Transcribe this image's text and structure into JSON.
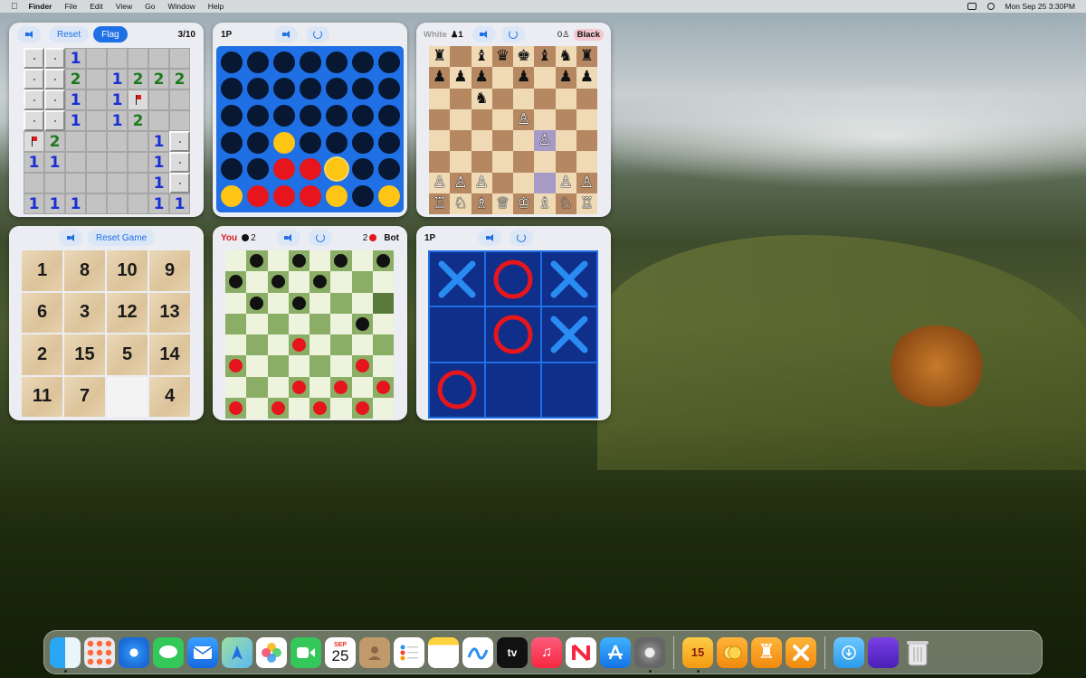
{
  "menubar": {
    "app_name": "Finder",
    "menus": [
      "File",
      "Edit",
      "View",
      "Go",
      "Window",
      "Help"
    ],
    "datetime": "Mon Sep 25  3:30PM"
  },
  "minesweeper": {
    "reset_label": "Reset",
    "flag_label": "Flag",
    "counter": "3/10",
    "grid": [
      [
        "c",
        "c",
        "1",
        "",
        "",
        "",
        "",
        ""
      ],
      [
        "c",
        "c",
        "2",
        "",
        "1",
        "2",
        "2",
        "2"
      ],
      [
        "c",
        "c",
        "1",
        "",
        "1",
        "F",
        "",
        ""
      ],
      [
        "c",
        "c",
        "1",
        "",
        "1",
        "2",
        "",
        ""
      ],
      [
        "F",
        "2",
        "",
        "",
        "",
        "",
        "1",
        "c"
      ],
      [
        "1",
        "1",
        "",
        "",
        "",
        "",
        "1",
        "c"
      ],
      [
        "",
        "",
        "",
        "",
        "",
        "",
        "1",
        "c"
      ],
      [
        "1",
        "1",
        "1",
        "",
        "",
        "",
        "1",
        "1"
      ]
    ]
  },
  "connect_four": {
    "mode": "1P",
    "grid": [
      [
        ".",
        ".",
        ".",
        ".",
        ".",
        ".",
        "."
      ],
      [
        ".",
        ".",
        ".",
        ".",
        ".",
        ".",
        "."
      ],
      [
        ".",
        ".",
        ".",
        ".",
        ".",
        ".",
        "."
      ],
      [
        ".",
        ".",
        "y",
        ".",
        ".",
        ".",
        "."
      ],
      [
        ".",
        ".",
        "r",
        "r",
        "Y",
        ".",
        "."
      ],
      [
        "y",
        "r",
        "r",
        "r",
        "y",
        ".",
        "y"
      ]
    ]
  },
  "chess": {
    "white_label": "White",
    "white_captured": "♟1",
    "black_captured": "0♙",
    "black_label": "Black",
    "board": [
      [
        "♜",
        "",
        "♝",
        "♛",
        "♚",
        "♝",
        "♞",
        "♜"
      ],
      [
        "♟",
        "♟",
        "♟",
        "",
        "♟",
        "",
        "♟",
        "♟"
      ],
      [
        "",
        "",
        "♞",
        "",
        "",
        "",
        "",
        ""
      ],
      [
        "",
        "",
        "",
        "",
        "♙",
        "",
        "",
        ""
      ],
      [
        "",
        "",
        "",
        "",
        "",
        "♙",
        "",
        ""
      ],
      [
        "",
        "",
        "",
        "",
        "",
        "",
        "",
        ""
      ],
      [
        "♙",
        "♙",
        "♙",
        "",
        "",
        "",
        "♙",
        "♙"
      ],
      [
        "♖",
        "♘",
        "♗",
        "♕",
        "♔",
        "♗",
        "♘",
        "♖"
      ]
    ],
    "highlight": [
      "4-5",
      "6-5"
    ]
  },
  "puzzle15": {
    "reset_label": "Reset Game",
    "tiles": [
      "1",
      "8",
      "10",
      "9",
      "6",
      "3",
      "12",
      "13",
      "2",
      "15",
      "5",
      "14",
      "11",
      "7",
      "",
      "4"
    ]
  },
  "checkers": {
    "you_label": "You",
    "you_score": "2",
    "bot_score": "2",
    "bot_label": "Bot",
    "board": [
      [
        "",
        "b",
        "",
        "b",
        "",
        "b",
        "",
        "b"
      ],
      [
        "b",
        "",
        "b",
        "",
        "b",
        "",
        "",
        ""
      ],
      [
        "",
        "b",
        "",
        "b",
        "",
        "",
        "",
        ""
      ],
      [
        "",
        "",
        "",
        "",
        "",
        "",
        "b",
        ""
      ],
      [
        "",
        "",
        "",
        "r",
        "",
        "",
        "",
        ""
      ],
      [
        "r",
        "",
        "",
        "",
        "",
        "",
        "r",
        ""
      ],
      [
        "",
        "",
        "",
        "r",
        "",
        "r",
        "",
        "r"
      ],
      [
        "r",
        "",
        "r",
        "",
        "r",
        "",
        "r",
        ""
      ]
    ],
    "selected": "2-7"
  },
  "tictactoe": {
    "mode": "1P",
    "grid": [
      "X",
      "O",
      "X",
      "",
      "O",
      "X",
      "O",
      "",
      ""
    ]
  },
  "dock": {
    "apps": [
      "Finder",
      "Launchpad",
      "Safari",
      "Messages",
      "Mail",
      "Maps",
      "Photos",
      "FaceTime",
      "Calendar",
      "Contacts",
      "Reminders",
      "Notes",
      "Freeform",
      "TV",
      "Music",
      "News",
      "App Store",
      "System Settings"
    ],
    "calendar_month": "SEP",
    "calendar_day": "25",
    "games": [
      "15 Puzzle",
      "Coins",
      "Chess",
      "Tic Tac Toe"
    ],
    "tv_label": "tv",
    "puzzle_icon_label": "15",
    "other": [
      "Downloads",
      "Screenshot",
      "Trash"
    ]
  },
  "colors": {
    "accent": "#1f6fe5",
    "c4_red": "#e6161c",
    "c4_yellow": "#ffc514",
    "ttt_board": "#1f6fe5",
    "ttt_cell": "#0f2f8a"
  }
}
